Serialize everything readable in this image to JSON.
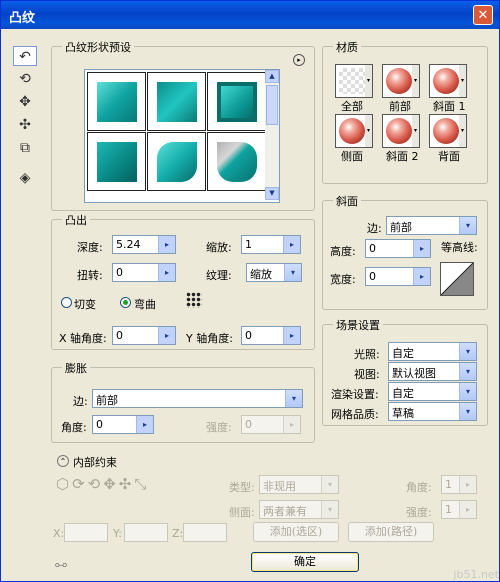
{
  "window": {
    "title": "凸纹",
    "close": "✕"
  },
  "preset": {
    "title": "凸纹形状预设",
    "scroll_up": "▲",
    "scroll_down": "▼",
    "options_arrow": "▸"
  },
  "material": {
    "title": "材质",
    "items": [
      {
        "label": "全部"
      },
      {
        "label": "前部"
      },
      {
        "label": "斜面 1"
      },
      {
        "label": "侧面"
      },
      {
        "label": "斜面 2"
      },
      {
        "label": "背面"
      }
    ]
  },
  "extrude": {
    "title": "凸出",
    "depth_label": "深度:",
    "depth_value": "5.24",
    "scale_label": "缩放:",
    "scale_value": "1",
    "twist_label": "扭转:",
    "twist_value": "0",
    "texture_label": "纹理:",
    "texture_value": "缩放",
    "opt_bevel": "切变",
    "opt_bend": "弯曲",
    "x_angle_label": "X 轴角度:",
    "x_angle_value": "0",
    "y_angle_label": "Y 轴角度:",
    "y_angle_value": "0"
  },
  "bevel": {
    "title": "斜面",
    "side_label": "边:",
    "side_value": "前部",
    "height_label": "高度:",
    "height_value": "0",
    "width_label": "宽度:",
    "width_value": "0",
    "contour_label": "等高线:"
  },
  "inflate": {
    "title": "膨胀",
    "side_label": "边:",
    "side_value": "前部",
    "angle_label": "角度:",
    "angle_value": "0",
    "strength_label": "强度:",
    "strength_value": "0"
  },
  "scene": {
    "title": "场景设置",
    "light_label": "光照:",
    "light_value": "自定",
    "view_label": "视图:",
    "view_value": "默认视图",
    "render_label": "渲染设置:",
    "render_value": "自定",
    "mesh_label": "网格品质:",
    "mesh_value": "草稿"
  },
  "internal": {
    "toggle": "⌃",
    "title": "内部约束",
    "type_label": "类型:",
    "type_value": "非现用",
    "side_label": "侧面:",
    "side_value": "两者兼有",
    "angle_label": "角度:",
    "angle_value": "1",
    "strength_label": "强度:",
    "strength_value": "1",
    "x_label": "X:",
    "y_label": "Y:",
    "z_label": "Z:",
    "add_selection": "添加(选区)",
    "add_path": "添加(路径)"
  },
  "footer": {
    "ok": "确定",
    "watermark": "jb51.net"
  },
  "icons": {
    "arrow": "▾",
    "spin": "▸"
  }
}
